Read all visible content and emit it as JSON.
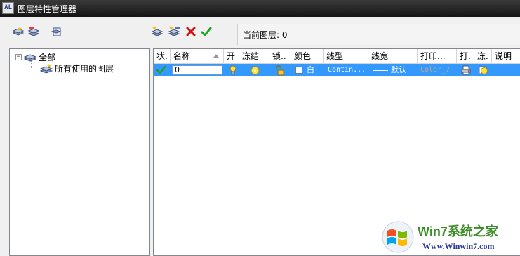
{
  "window": {
    "app_icon": "AL",
    "title": "图层特性管理器"
  },
  "toolbar": {
    "left_icons": [
      "new-property-filter-icon",
      "new-group-filter-icon",
      "layer-states-manager-icon"
    ],
    "right_icons": [
      "new-layer-icon",
      "new-layer-vp-frozen-icon",
      "delete-layer-icon",
      "set-current-icon"
    ],
    "current_layer_label": "当前图层: 0"
  },
  "tree": {
    "root_toggle": "−",
    "root_label": "全部",
    "child_label": "所有使用的图层"
  },
  "columns": [
    "状.",
    "名称",
    "开",
    "冻结",
    "锁..",
    "颜色",
    "线型",
    "线宽",
    "打印...",
    "打.",
    "冻.",
    "说明"
  ],
  "layers": [
    {
      "status": "✔",
      "name": "0",
      "on": "on",
      "freeze": "thawed",
      "lock": "unlocked",
      "color": "白",
      "color_hex": "#ffffff",
      "linetype": "Contin...",
      "lineweight": "默认",
      "plot_style": "Color_7",
      "plot": "printable",
      "vp_freeze": "thawed",
      "description": ""
    }
  ],
  "watermark": {
    "brand": "Win7系统之家",
    "url": "Www.Winwin7.com"
  },
  "colors": {
    "selection": "#3399ff",
    "check": "#22a022",
    "delete": "#cc1111",
    "bulb": "#ffe23a"
  }
}
